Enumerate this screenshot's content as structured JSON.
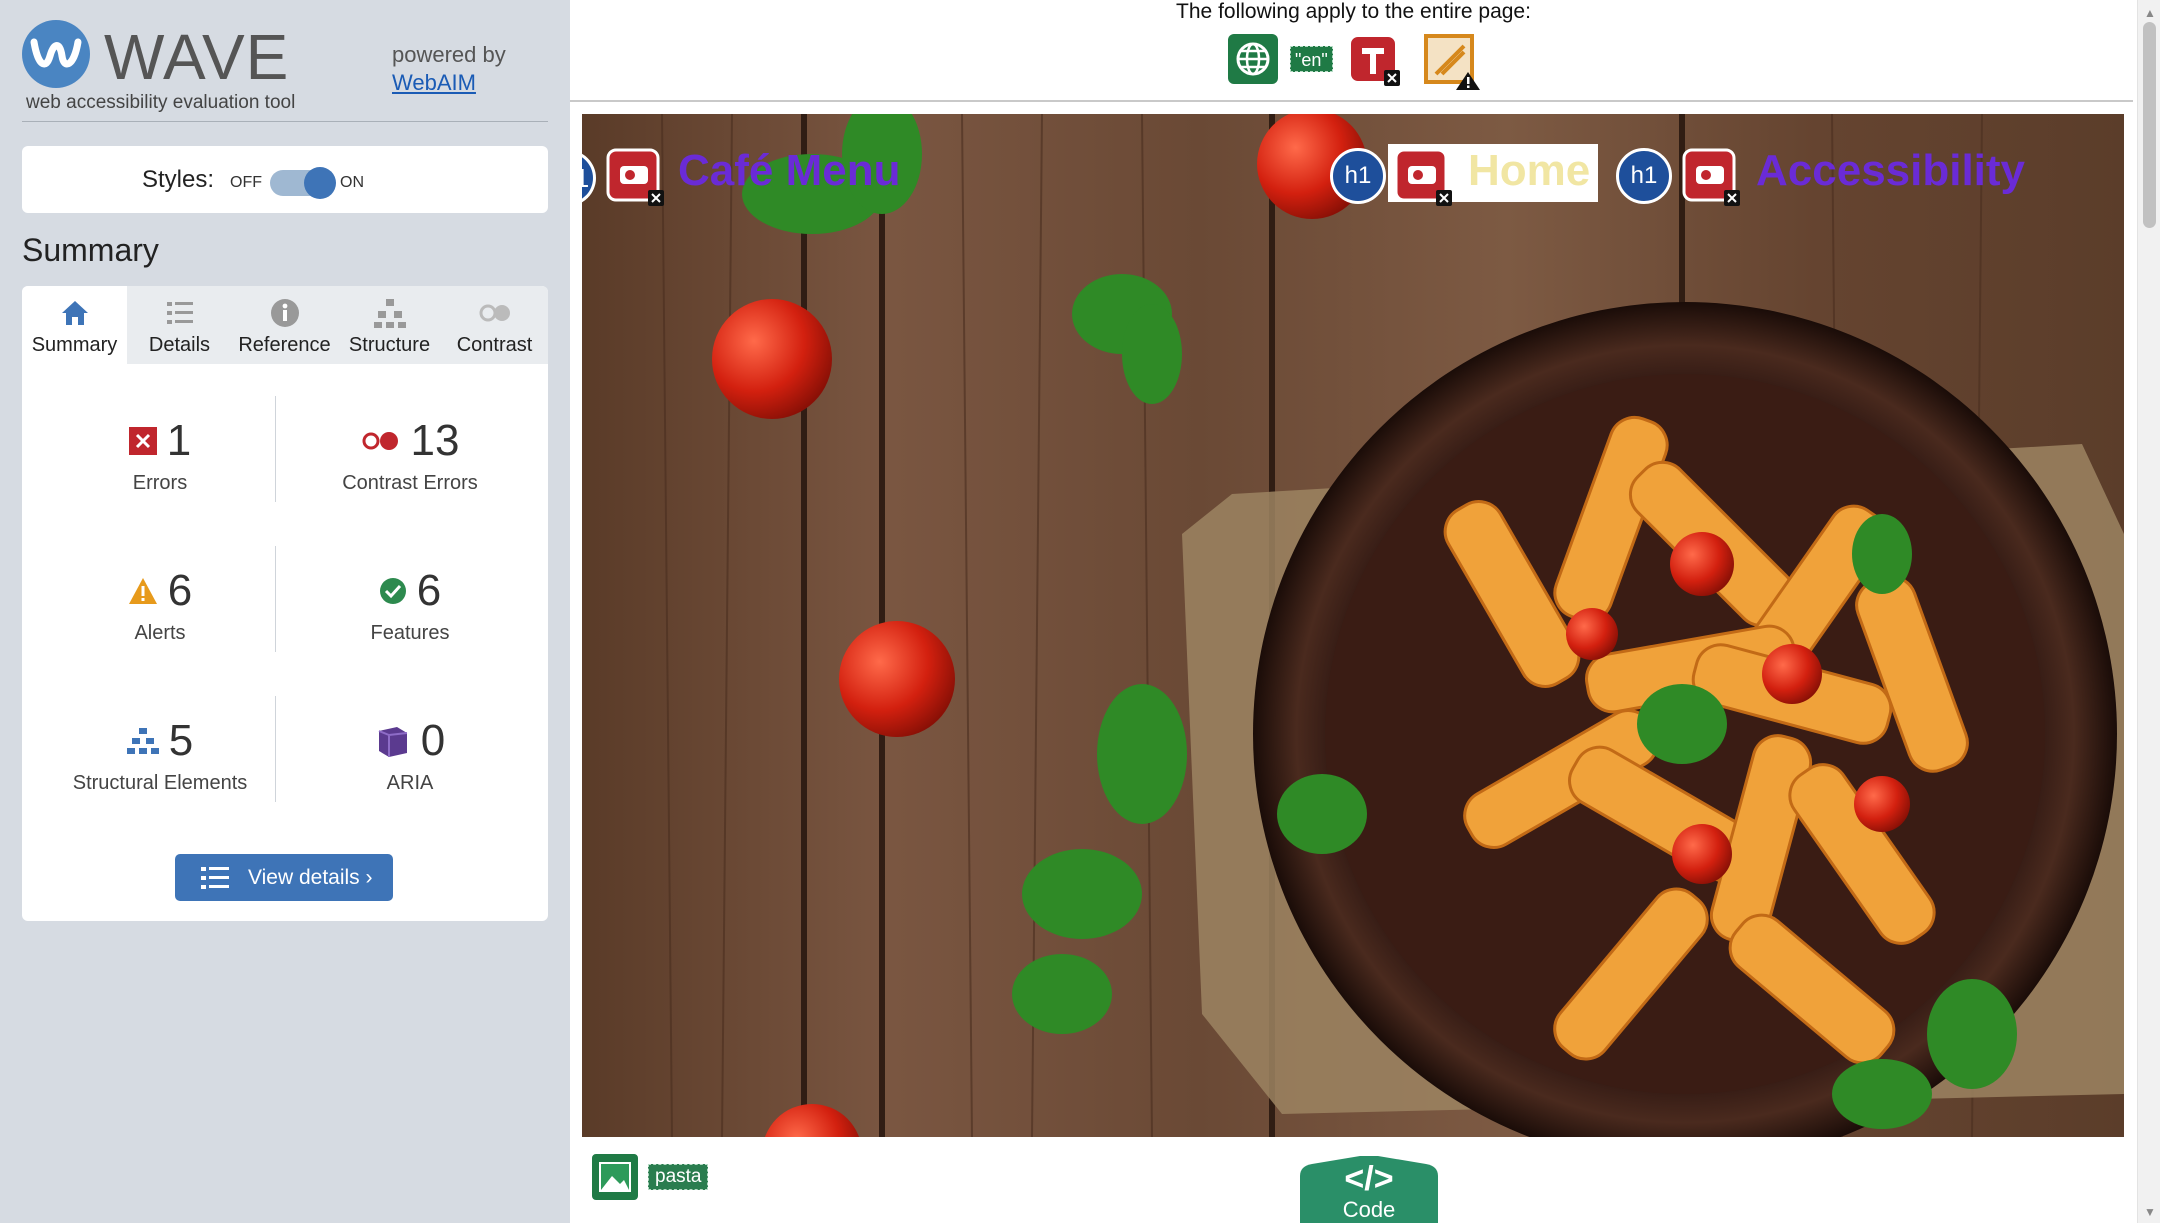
{
  "sidebar": {
    "brand_name": "WAVE",
    "brand_sub": "web accessibility evaluation tool",
    "powered_by": "powered by",
    "webaim_link": "WebAIM",
    "styles": {
      "label": "Styles:",
      "off": "OFF",
      "on": "ON",
      "state": "on"
    },
    "summary_title": "Summary",
    "tabs": [
      {
        "label": "Summary",
        "icon": "home-icon",
        "active": true
      },
      {
        "label": "Details",
        "icon": "list-icon",
        "active": false
      },
      {
        "label": "Reference",
        "icon": "info-icon",
        "active": false
      },
      {
        "label": "Structure",
        "icon": "hierarchy-icon",
        "active": false
      },
      {
        "label": "Contrast",
        "icon": "contrast-icon",
        "active": false
      }
    ],
    "stats": {
      "errors": {
        "count": "1",
        "label": "Errors",
        "color": "#c0262d"
      },
      "contrast": {
        "count": "13",
        "label": "Contrast Errors",
        "color": "#c0262d"
      },
      "alerts": {
        "count": "6",
        "label": "Alerts",
        "color": "#e79a1b"
      },
      "features": {
        "count": "6",
        "label": "Features",
        "color": "#2d8a4e"
      },
      "structure": {
        "count": "5",
        "label": "Structural Elements",
        "color": "#3e74b7"
      },
      "aria": {
        "count": "0",
        "label": "ARIA",
        "color": "#5b3a8f"
      }
    },
    "view_details": "View details ›"
  },
  "page": {
    "apply_title": "The following apply to the entire page:",
    "page_icons": [
      "language-globe-icon",
      "lang-en-tag",
      "missing-title-error-icon",
      "noscript-alert-icon"
    ],
    "lang_tag": "\"en\"",
    "nav": {
      "cafe_menu": "Café Menu",
      "home": "Home",
      "accessibility": "Accessibility"
    },
    "h1_label": "h1",
    "h1_partial": "1",
    "alt_text": "pasta",
    "code_label": "Code",
    "code_glyph": "</>"
  },
  "colors": {
    "wave_blue": "#3e74b7",
    "error_red": "#c0262d",
    "nav_purple": "#6a2bd6",
    "home_text": "#f1e6a3",
    "feature_green": "#1f7a45"
  }
}
